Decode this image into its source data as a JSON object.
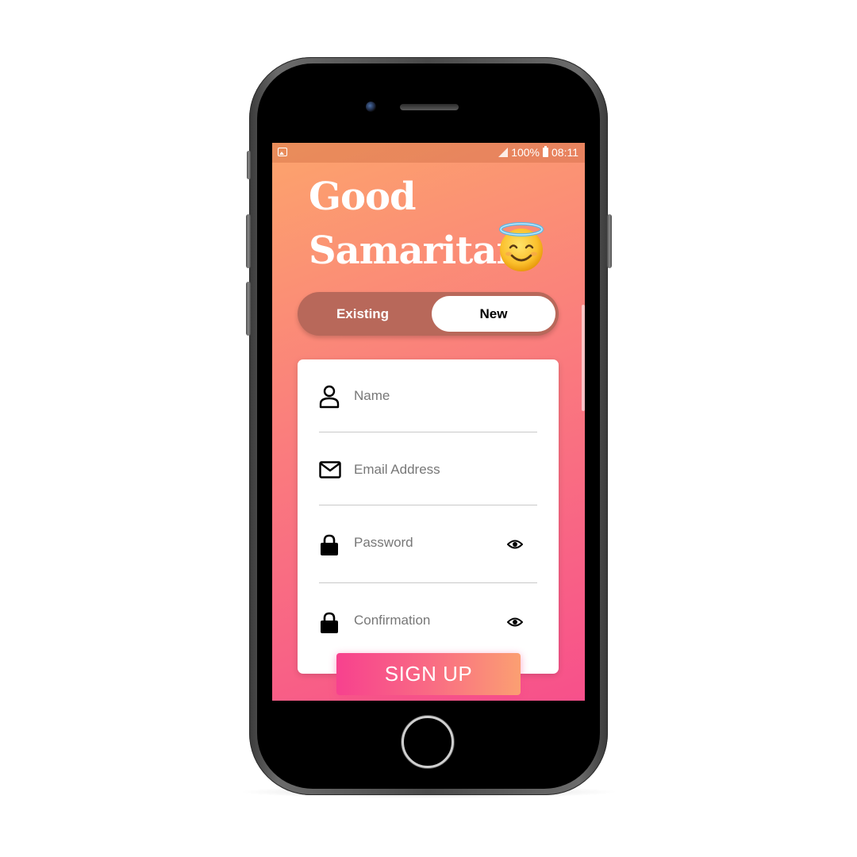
{
  "status_bar": {
    "battery": "100%",
    "time": "08:11"
  },
  "app": {
    "title_line1": "Good",
    "title_line2": "Samaritan",
    "emoji": "smiling-face-with-halo"
  },
  "toggle": {
    "existing_label": "Existing",
    "new_label": "New",
    "selected": "New"
  },
  "form": {
    "name_placeholder": "Name",
    "email_placeholder": "Email Address",
    "password_placeholder": "Password",
    "confirmation_placeholder": "Confirmation"
  },
  "actions": {
    "signup_label": "SIGN UP"
  },
  "colors": {
    "gradient_top": "#fca46c",
    "gradient_bottom": "#f7508b",
    "toggle_track": "#b8685a",
    "button_start": "#f7418e",
    "button_end": "#fb9f72"
  },
  "icons": [
    "image-icon",
    "signal-icon",
    "battery-icon",
    "user-icon",
    "mail-icon",
    "lock-icon",
    "eye-icon"
  ]
}
